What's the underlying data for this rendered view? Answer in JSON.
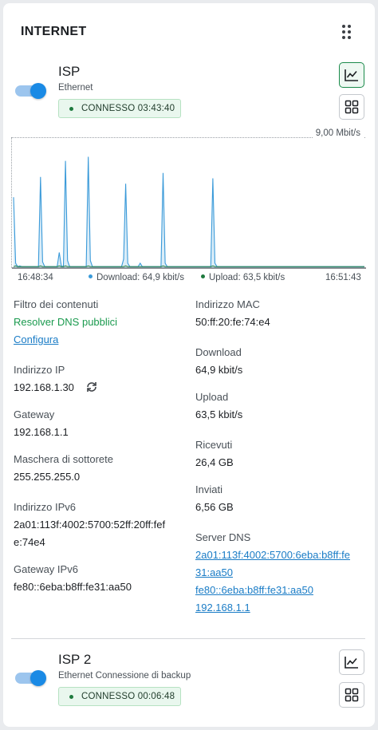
{
  "widget": {
    "title": "INTERNET"
  },
  "isp1": {
    "name": "ISP",
    "type": "Ethernet",
    "status": "CONNESSO 03:43:40",
    "enabled": true
  },
  "chart_data": {
    "type": "area",
    "title": "",
    "ymax_label": "9,00 Mbit/s",
    "ylim": [
      0,
      9
    ],
    "x_start_label": "16:48:34",
    "x_end_label": "16:51:43",
    "series": [
      {
        "name": "Download: 64,9 kbit/s",
        "color": "#3a9ad9",
        "values": [
          5.2,
          0.3,
          0.05,
          0.1,
          0.05,
          0.05,
          0.05,
          0.05,
          0.05,
          0.05,
          0.05,
          0.05,
          0.05,
          6.7,
          0.4,
          0.05,
          0.05,
          0.05,
          0.05,
          0.05,
          0.05,
          0.05,
          1.1,
          0.1,
          0.05,
          7.9,
          0.5,
          0.05,
          0.05,
          0.05,
          0.05,
          0.05,
          0.05,
          0.05,
          0.05,
          0.05,
          8.2,
          0.5,
          0.05,
          0.05,
          0.05,
          0.05,
          0.05,
          0.05,
          0.05,
          0.05,
          0.05,
          0.05,
          0.05,
          0.05,
          0.05,
          0.05,
          0.05,
          0.6,
          6.2,
          0.3,
          0.05,
          0.05,
          0.05,
          0.05,
          0.05,
          0.3,
          0.05,
          0.05,
          0.05,
          0.05,
          0.05,
          0.05,
          0.05,
          0.05,
          0.05,
          0.05,
          7.0,
          0.3,
          0.05,
          0.05,
          0.05,
          0.05,
          0.05,
          0.05,
          0.05,
          0.05,
          0.05,
          0.05,
          0.05,
          0.05,
          0.05,
          0.05,
          0.05,
          0.05,
          0.05,
          0.05,
          0.05,
          0.05,
          0.05,
          0.05,
          6.6,
          0.3,
          0.05,
          0.05,
          0.05,
          0.05,
          0.05,
          0.05,
          0.05,
          0.05,
          0.05,
          0.05,
          0.05,
          0.05,
          0.05,
          0.05,
          0.05,
          0.05,
          0.05,
          0.05,
          0.05,
          0.05,
          0.05,
          0.05,
          0.05,
          0.05,
          0.05,
          0.05,
          0.05,
          0.05,
          0.05,
          0.05,
          0.05,
          0.05,
          0.05,
          0.05,
          0.05,
          0.05,
          0.05,
          0.05,
          0.05,
          0.05,
          0.05,
          0.05,
          0.05,
          0.05,
          0.05,
          0.05,
          0.05,
          0.05,
          0.05,
          0.05,
          0.05,
          0.05,
          0.05,
          0.05,
          0.05,
          0.05,
          0.05,
          0.05,
          0.05,
          0.05,
          0.05,
          0.05,
          0.05,
          0.05,
          0.05,
          0.05,
          0.05,
          0.05,
          0.05,
          0.05,
          0.05,
          0.05
        ]
      },
      {
        "name": "Upload: 63,5 kbit/s",
        "color": "#1e7a3e",
        "values": [
          0.05,
          0.1,
          0.05,
          0.05,
          0.05,
          0.05,
          0.05,
          0.05,
          0.05,
          0.05,
          0.05,
          0.05,
          0.05,
          0.1,
          0.05,
          0.05,
          0.05,
          0.05,
          0.05,
          0.05,
          0.05,
          0.05,
          0.1,
          0.05,
          0.05,
          0.1,
          0.05,
          0.05,
          0.05,
          0.05,
          0.05,
          0.05,
          0.05,
          0.05,
          0.05,
          0.05,
          0.1,
          0.05,
          0.05,
          0.05,
          0.05,
          0.05,
          0.05,
          0.05,
          0.05,
          0.05,
          0.05,
          0.05,
          0.05,
          0.05,
          0.05,
          0.05,
          0.05,
          0.05,
          0.1,
          0.05,
          0.05,
          0.05,
          0.05,
          0.05,
          0.05,
          0.05,
          0.05,
          0.05,
          0.05,
          0.05,
          0.05,
          0.05,
          0.05,
          0.05,
          0.05,
          0.05,
          0.1,
          0.05,
          0.05,
          0.05,
          0.05,
          0.05,
          0.05,
          0.05,
          0.05,
          0.05,
          0.05,
          0.05,
          0.05,
          0.05,
          0.05,
          0.05,
          0.05,
          0.05,
          0.05,
          0.05,
          0.05,
          0.05,
          0.05,
          0.05,
          0.1,
          0.05,
          0.05,
          0.05,
          0.05,
          0.05,
          0.05,
          0.05,
          0.05,
          0.05,
          0.05,
          0.05,
          0.05,
          0.05,
          0.05,
          0.05,
          0.05,
          0.05,
          0.05,
          0.05,
          0.05,
          0.05,
          0.05,
          0.05,
          0.05,
          0.05,
          0.05,
          0.05,
          0.05,
          0.05,
          0.05,
          0.05,
          0.05,
          0.05,
          0.05,
          0.05,
          0.05,
          0.05,
          0.05,
          0.05,
          0.05,
          0.05,
          0.05,
          0.05,
          0.05,
          0.05,
          0.05,
          0.05,
          0.05,
          0.05,
          0.05,
          0.05,
          0.05,
          0.05,
          0.05,
          0.05,
          0.05,
          0.05,
          0.05,
          0.05,
          0.05,
          0.05,
          0.05,
          0.05,
          0.05,
          0.05,
          0.05,
          0.05,
          0.05,
          0.05,
          0.05,
          0.05,
          0.05,
          0.05
        ]
      }
    ]
  },
  "details_left": {
    "filter_label": "Filtro dei contenuti",
    "filter_value": "Resolver DNS pubblici",
    "configure_link": "Configura",
    "ip_label": "Indirizzo IP",
    "ip_value": "192.168.1.30",
    "gateway_label": "Gateway",
    "gateway_value": "192.168.1.1",
    "mask_label": "Maschera di sottorete",
    "mask_value": "255.255.255.0",
    "ipv6_label": "Indirizzo IPv6",
    "ipv6_value_1": "2a01:113f:4002:5700:52ff:20ff:fef",
    "ipv6_value_2": "e:74e4",
    "gw6_label": "Gateway IPv6",
    "gw6_value": "fe80::6eba:b8ff:fe31:aa50"
  },
  "details_right": {
    "mac_label": "Indirizzo MAC",
    "mac_value": "50:ff:20:fe:74:e4",
    "download_label": "Download",
    "download_value": "64,9 kbit/s",
    "upload_label": "Upload",
    "upload_value": "63,5 kbit/s",
    "received_label": "Ricevuti",
    "received_value": "26,4 GB",
    "sent_label": "Inviati",
    "sent_value": "6,56 GB",
    "dns_label": "Server DNS",
    "dns_1a": "2a01:113f:4002:5700:6eba:b8ff:fe",
    "dns_1b": "31:aa50",
    "dns_2": "fe80::6eba:b8ff:fe31:aa50",
    "dns_3": "192.168.1.1"
  },
  "isp2": {
    "name": "ISP 2",
    "type": "Ethernet Connessione di backup",
    "status": "CONNESSO 00:06:48",
    "enabled": true
  },
  "icons": {
    "drag": "drag-handle-icon",
    "chart": "line-chart-icon",
    "grid": "grid-icon",
    "refresh": "refresh-icon"
  }
}
